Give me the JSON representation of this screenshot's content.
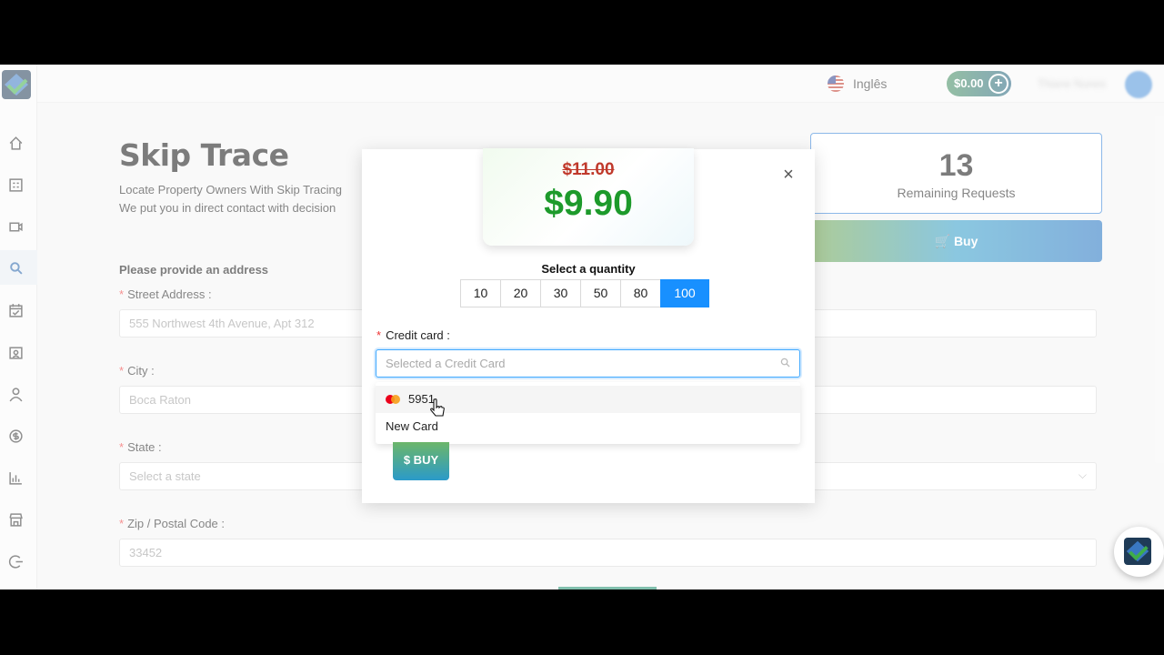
{
  "header": {
    "language": "Inglês",
    "balance": "$0.00",
    "balance_add": "+",
    "username": "Thiane Nunes"
  },
  "page": {
    "title": "Skip Trace",
    "desc_line1": "Locate Property Owners With Skip Tracing",
    "desc_line2": "We put you in direct contact with decision",
    "remaining_count": "13",
    "remaining_label": "Remaining Requests",
    "buy_label": "Buy",
    "section_title": "Please provide an address",
    "street_label": "Street Address",
    "street_value": "555 Northwest 4th Avenue, Apt 312",
    "city_label": "City",
    "city_value": "Boca Raton",
    "state_label": "State",
    "state_placeholder": "Select a state",
    "zip_label": "Zip / Postal Code",
    "zip_value": "33452"
  },
  "modal": {
    "old_price": "$11.00",
    "new_price": "$9.90",
    "quantity_title": "Select a quantity",
    "quantities": [
      "10",
      "20",
      "30",
      "50",
      "80",
      "100"
    ],
    "selected_quantity": "100",
    "credit_card_label": "Credit card",
    "credit_card_placeholder": "Selected a Credit Card",
    "card_options": [
      "5951",
      "New Card"
    ],
    "buy_label": "$ BUY",
    "close": "×"
  },
  "colors": {
    "accent": "#1890ff",
    "price_green": "#1d9a2b",
    "old_price_red": "#c0392b"
  }
}
